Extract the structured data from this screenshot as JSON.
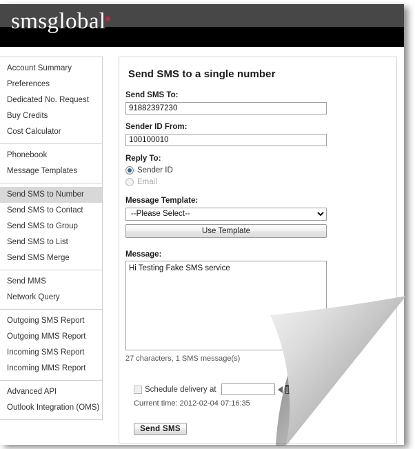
{
  "brand": {
    "logo_text": "smsglobal",
    "logo_dot": "registered-dot",
    "header_top_color": "#474747",
    "header_bottom_color": "#000000",
    "accent_color": "#c0283a"
  },
  "sidebar": {
    "groups": [
      {
        "items": [
          {
            "label": "Account Summary",
            "name": "account-summary",
            "active": false
          },
          {
            "label": "Preferences",
            "name": "preferences",
            "active": false
          },
          {
            "label": "Dedicated No. Request",
            "name": "dedicated-no-request",
            "active": false
          },
          {
            "label": "Buy Credits",
            "name": "buy-credits",
            "active": false
          },
          {
            "label": "Cost Calculator",
            "name": "cost-calculator",
            "active": false
          }
        ]
      },
      {
        "items": [
          {
            "label": "Phonebook",
            "name": "phonebook",
            "active": false
          },
          {
            "label": "Message Templates",
            "name": "message-templates",
            "active": false
          }
        ]
      },
      {
        "items": [
          {
            "label": "Send SMS to Number",
            "name": "send-sms-to-number",
            "active": true
          },
          {
            "label": "Send SMS to Contact",
            "name": "send-sms-to-contact",
            "active": false
          },
          {
            "label": "Send SMS to Group",
            "name": "send-sms-to-group",
            "active": false
          },
          {
            "label": "Send SMS to List",
            "name": "send-sms-to-list",
            "active": false
          },
          {
            "label": "Send SMS Merge",
            "name": "send-sms-merge",
            "active": false
          }
        ]
      },
      {
        "items": [
          {
            "label": "Send MMS",
            "name": "send-mms",
            "active": false
          },
          {
            "label": "Network Query",
            "name": "network-query",
            "active": false
          }
        ]
      },
      {
        "items": [
          {
            "label": "Outgoing SMS Report",
            "name": "outgoing-sms-report",
            "active": false
          },
          {
            "label": "Outgoing MMS Report",
            "name": "outgoing-mms-report",
            "active": false
          },
          {
            "label": "Incoming SMS Report",
            "name": "incoming-sms-report",
            "active": false
          },
          {
            "label": "Incoming MMS Report",
            "name": "incoming-mms-report",
            "active": false
          }
        ]
      },
      {
        "items": [
          {
            "label": "Advanced API",
            "name": "advanced-api",
            "active": false
          },
          {
            "label": "Outlook Integration (OMS)",
            "name": "outlook-integration-oms",
            "active": false
          }
        ]
      }
    ]
  },
  "form": {
    "title": "Send SMS to a single number",
    "send_to": {
      "label": "Send SMS To:",
      "value": "91882397230",
      "placeholder": ""
    },
    "sender_id": {
      "label": "Sender ID From:",
      "value": "100100010",
      "placeholder": ""
    },
    "reply_to": {
      "label": "Reply To:",
      "options": [
        {
          "label": "Sender ID",
          "selected": true,
          "disabled": false
        },
        {
          "label": "Email",
          "selected": false,
          "disabled": true
        }
      ]
    },
    "message_template": {
      "label": "Message Template:",
      "selected": "--Please Select--",
      "options": [
        "--Please Select--"
      ],
      "use_template_button": "Use Template"
    },
    "message": {
      "label": "Message:",
      "value": "Hi Testing Fake SMS service",
      "placeholder": "",
      "char_count": "27 characters, 1 SMS message(s)"
    },
    "schedule": {
      "checkbox_label": "Schedule delivery at",
      "checked": false,
      "disabled": true,
      "value": "",
      "placeholder": "",
      "picker_icon": "triangle-left-icon",
      "calendar_icon": "calendar-icon",
      "current_time": "Current time: 2012-02-04 07:16:35"
    },
    "submit_button": "Send  SMS"
  }
}
